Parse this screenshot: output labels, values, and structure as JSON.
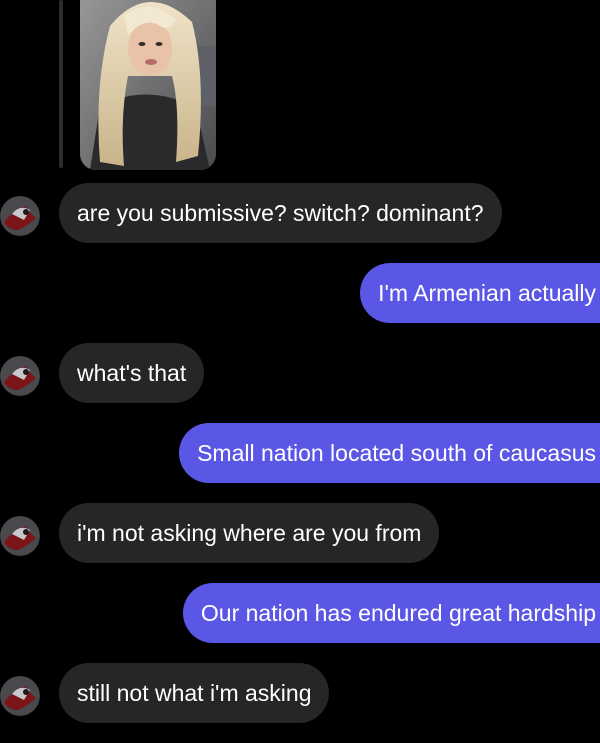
{
  "colors": {
    "background": "#000000",
    "incoming_bubble": "#262628",
    "outgoing_bubble": "#5a57e6",
    "text": "#ffffff"
  },
  "shared_media": {
    "type": "photo",
    "icon": "photo-thumbnail"
  },
  "contact": {
    "avatar_icon": "avatar-icon"
  },
  "messages": [
    {
      "direction": "incoming",
      "text": "are you submissive? switch? dominant?"
    },
    {
      "direction": "outgoing",
      "text": "I'm Armenian actually"
    },
    {
      "direction": "incoming",
      "text": "what's that"
    },
    {
      "direction": "outgoing",
      "text": "Small nation located south of caucasus"
    },
    {
      "direction": "incoming",
      "text": "i'm not asking where are you from"
    },
    {
      "direction": "outgoing",
      "text": "Our nation has endured great hardship"
    },
    {
      "direction": "incoming",
      "text": "still not what i'm asking"
    }
  ]
}
